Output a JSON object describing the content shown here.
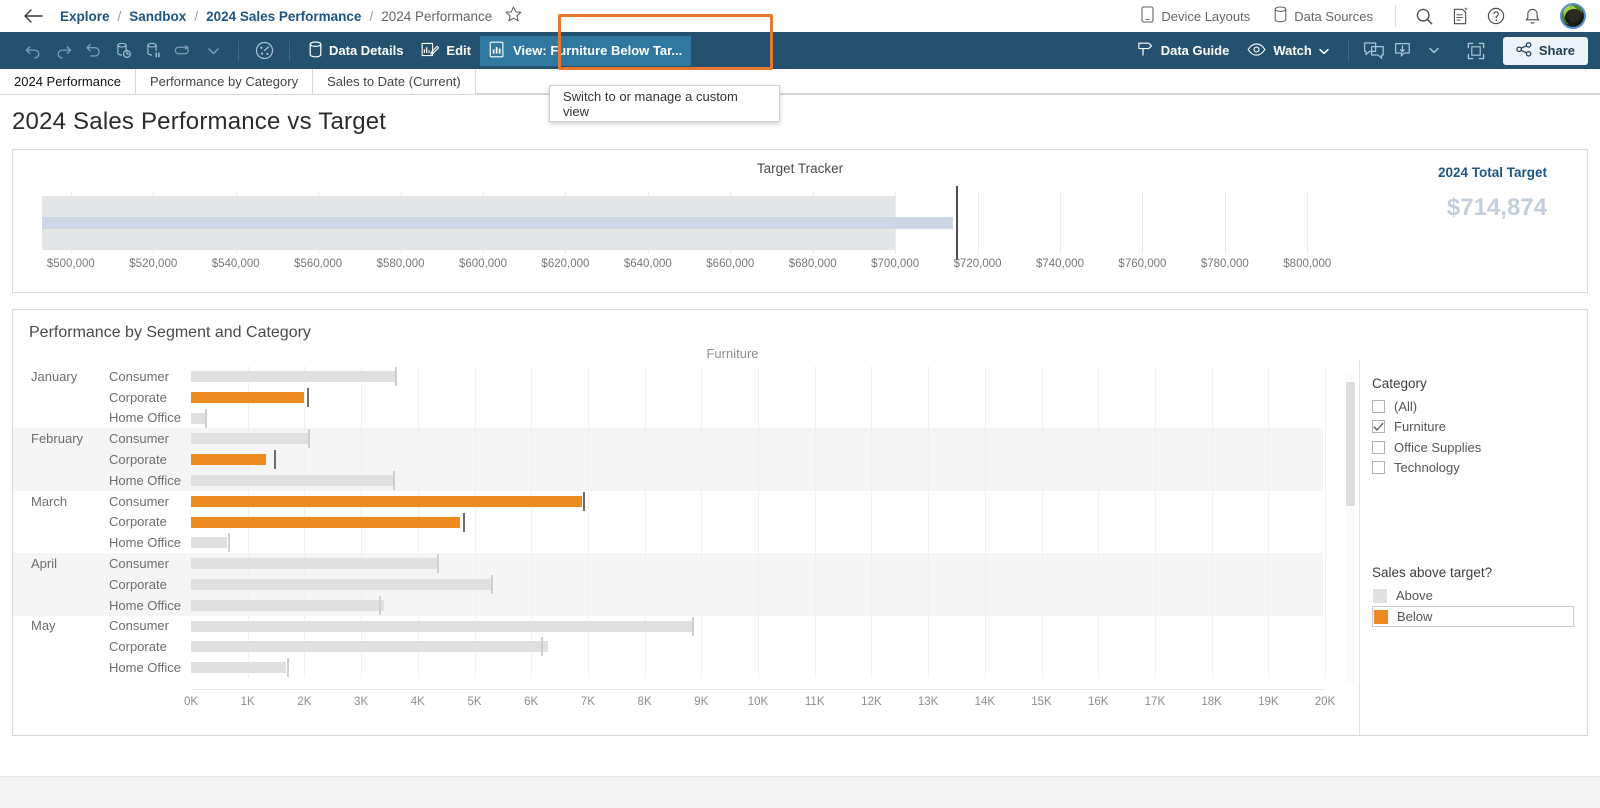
{
  "breadcrumb": {
    "back_icon": "back-arrow-icon",
    "items": [
      {
        "label": "Explore",
        "current": false
      },
      {
        "label": "Sandbox",
        "current": false
      },
      {
        "label": "2024 Sales Performance",
        "current": false
      },
      {
        "label": "2024 Performance",
        "current": true
      }
    ],
    "separator": "/",
    "favorite_icon": "star-icon"
  },
  "topbar_right": {
    "device_layouts": "Device Layouts",
    "data_sources": "Data Sources",
    "search_icon": "search-icon",
    "edit_note_icon": "note-star-icon",
    "help_icon": "help-circle-icon",
    "alerts_icon": "bell-icon",
    "avatar": "user-avatar"
  },
  "toolbar": {
    "undo": "undo-icon",
    "redo": "redo-icon",
    "revert": "revert-icon",
    "refresh": "refresh-data-icon",
    "pause": "pause-data-icon",
    "view_original": "view-original-icon",
    "dropdown_caret": "caret-down-icon",
    "metrics": "metrics-icon",
    "data_details": "Data Details",
    "edit": "Edit",
    "view_custom": "View: Furniture Below Tar...",
    "data_guide": "Data Guide",
    "watch": "Watch",
    "comments_icon": "comment-icon",
    "download_icon": "download-icon",
    "fullscreen_icon": "fullscreen-icon",
    "share": "Share"
  },
  "tooltip": {
    "text": "Switch to or manage a custom view"
  },
  "tabs": [
    {
      "label": "2024 Performance",
      "active": true
    },
    {
      "label": "Performance by Category",
      "active": false
    },
    {
      "label": "Sales to Date (Current)",
      "active": false
    }
  ],
  "dashboard": {
    "title": "2024 Sales Performance vs Target"
  },
  "chart_data": [
    {
      "type": "bar",
      "subtype": "bullet",
      "title": "Target Tracker",
      "orientation": "horizontal",
      "xlabel": "",
      "ylabel": "",
      "xlim": [
        493000,
        806000
      ],
      "ticks": [
        "$500,000",
        "$520,000",
        "$540,000",
        "$560,000",
        "$580,000",
        "$600,000",
        "$620,000",
        "$640,000",
        "$660,000",
        "$680,000",
        "$700,000",
        "$720,000",
        "$740,000",
        "$760,000",
        "$780,000",
        "$800,000"
      ],
      "tick_values": [
        500000,
        520000,
        540000,
        560000,
        580000,
        600000,
        620000,
        640000,
        660000,
        680000,
        700000,
        720000,
        740000,
        760000,
        780000,
        800000
      ],
      "band_value": 700000,
      "actual_value": 714000,
      "reference_value": 714874,
      "grid": true,
      "kpi": {
        "label": "2024 Total Target",
        "value": "$714,874"
      }
    },
    {
      "type": "bar",
      "subtype": "bullet",
      "title": "Performance by Segment and Category",
      "category_header": "Furniture",
      "orientation": "horizontal",
      "xlabel": "",
      "ylabel": "",
      "xlim": [
        0,
        20000
      ],
      "ticks": [
        "0K",
        "1K",
        "2K",
        "3K",
        "4K",
        "5K",
        "6K",
        "7K",
        "8K",
        "9K",
        "10K",
        "11K",
        "12K",
        "13K",
        "14K",
        "15K",
        "16K",
        "17K",
        "18K",
        "19K",
        "20K"
      ],
      "tick_values": [
        0,
        1000,
        2000,
        3000,
        4000,
        5000,
        6000,
        7000,
        8000,
        9000,
        10000,
        11000,
        12000,
        13000,
        14000,
        15000,
        16000,
        17000,
        18000,
        19000,
        20000
      ],
      "grid": true,
      "legend_position": "right",
      "rows": [
        {
          "month": "January",
          "segment": "Consumer",
          "value": 3600,
          "target": 3600,
          "status": "Above",
          "shaded": false
        },
        {
          "month": "January",
          "segment": "Corporate",
          "value": 1990,
          "target": 2040,
          "status": "Below",
          "shaded": false
        },
        {
          "month": "January",
          "segment": "Home Office",
          "value": 240,
          "target": 250,
          "status": "Above",
          "shaded": false
        },
        {
          "month": "February",
          "segment": "Consumer",
          "value": 2070,
          "target": 2070,
          "status": "Above",
          "shaded": true
        },
        {
          "month": "February",
          "segment": "Corporate",
          "value": 1330,
          "target": 1460,
          "status": "Below",
          "shaded": true
        },
        {
          "month": "February",
          "segment": "Home Office",
          "value": 3570,
          "target": 3560,
          "status": "Above",
          "shaded": true
        },
        {
          "month": "March",
          "segment": "Consumer",
          "value": 6900,
          "target": 6920,
          "status": "Below",
          "shaded": false
        },
        {
          "month": "March",
          "segment": "Corporate",
          "value": 4750,
          "target": 4790,
          "status": "Below",
          "shaded": false
        },
        {
          "month": "March",
          "segment": "Home Office",
          "value": 640,
          "target": 650,
          "status": "Above",
          "shaded": false
        },
        {
          "month": "April",
          "segment": "Consumer",
          "value": 4380,
          "target": 4340,
          "status": "Above",
          "shaded": true
        },
        {
          "month": "April",
          "segment": "Corporate",
          "value": 5330,
          "target": 5290,
          "status": "Above",
          "shaded": true
        },
        {
          "month": "April",
          "segment": "Home Office",
          "value": 3400,
          "target": 3320,
          "status": "Above",
          "shaded": true
        },
        {
          "month": "May",
          "segment": "Consumer",
          "value": 8880,
          "target": 8830,
          "status": "Above",
          "shaded": false
        },
        {
          "month": "May",
          "segment": "Corporate",
          "value": 6290,
          "target": 6180,
          "status": "Above",
          "shaded": false
        },
        {
          "month": "May",
          "segment": "Home Office",
          "value": 1680,
          "target": 1700,
          "status": "Above",
          "shaded": false
        }
      ],
      "colors": {
        "below": "#ed8b22",
        "above": "#e0e0e0",
        "reference": "#6e6e6e"
      }
    }
  ],
  "filters": {
    "category": {
      "title": "Category",
      "options": [
        {
          "label": "(All)",
          "checked": false
        },
        {
          "label": "Furniture",
          "checked": true
        },
        {
          "label": "Office Supplies",
          "checked": false
        },
        {
          "label": "Technology",
          "checked": false
        }
      ]
    },
    "legend": {
      "title": "Sales above target?",
      "items": [
        {
          "label": "Above",
          "color": "#e0e0e0",
          "selected": false
        },
        {
          "label": "Below",
          "color": "#ed8b22",
          "selected": true
        }
      ]
    }
  }
}
